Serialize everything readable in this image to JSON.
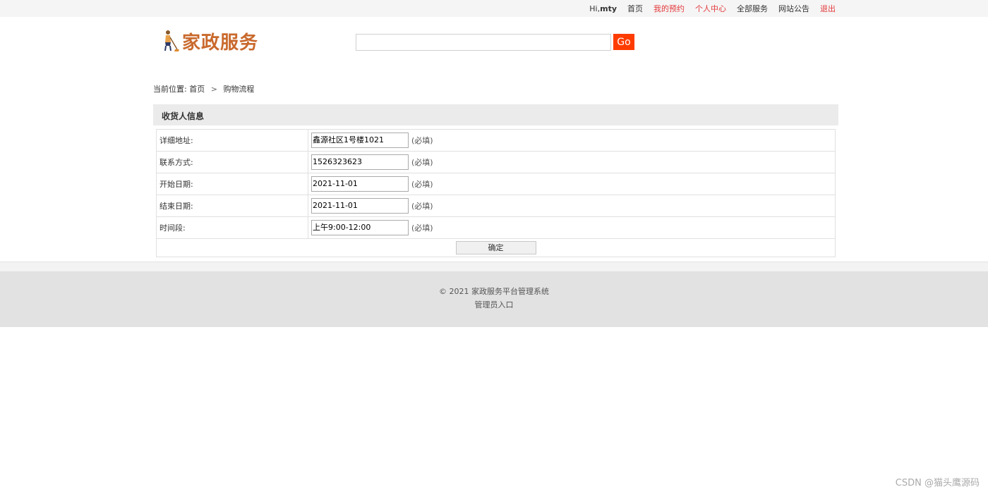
{
  "topnav": {
    "greeting": "Hi,",
    "username": "mty",
    "home": "首页",
    "my_bookings": "我的预约",
    "user_center": "个人中心",
    "all_services": "全部服务",
    "announcements": "网站公告",
    "logout": "退出"
  },
  "logo": {
    "text": "家政服务"
  },
  "search": {
    "value": "",
    "button": "Go"
  },
  "breadcrumb": {
    "prefix": "当前位置:",
    "home": "首页",
    "separator": ">",
    "current": "购物流程"
  },
  "section": {
    "title": "收货人信息"
  },
  "form": {
    "rows": [
      {
        "label": "详细地址:",
        "value": "鑫源社区1号楼1021",
        "note": "(必填)"
      },
      {
        "label": "联系方式:",
        "value": "1526323623",
        "note": "(必填)"
      },
      {
        "label": "开始日期:",
        "value": "2021-11-01",
        "note": "(必填)"
      },
      {
        "label": "结束日期:",
        "value": "2021-11-01",
        "note": "(必填)"
      },
      {
        "label": "时间段:",
        "value": "上午9:00-12:00",
        "note": "(必填)"
      }
    ],
    "submit": "确定"
  },
  "footer": {
    "copyright": "© 2021 家政服务平台管理系统",
    "admin_link": "管理员入口"
  },
  "watermark": "CSDN @猫头鹰源码",
  "colors": {
    "accent": "#ff3c00",
    "logo": "#c9692d",
    "link_red": "#e4393c"
  }
}
